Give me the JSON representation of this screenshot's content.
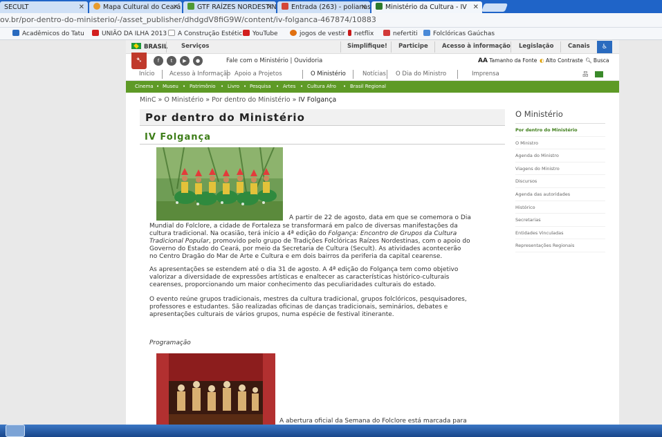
{
  "tabs": [
    {
      "label": "SECULT",
      "color": "#7aa4d8"
    },
    {
      "label": "Mapa Cultural do Ceará",
      "color": "#e89b2c"
    },
    {
      "label": "GTF RAÍZES NORDESTIN",
      "color": "#4f9a35"
    },
    {
      "label": "Entrada (263) - polianas",
      "color": "#d44638"
    },
    {
      "label": "Ministério da Cultura - IV",
      "color": "#2d7a2d"
    }
  ],
  "url": "ov.br/por-dentro-do-ministerio/-/asset_publisher/dhdgdV8fiG9W/content/iv-folganca-467874/10883",
  "bookmarks": [
    {
      "label": "Acadêmicos do Tatu",
      "color": "#2a6bbf"
    },
    {
      "label": "UNIÃO DA ILHA 2013",
      "color": "#d21f1f"
    },
    {
      "label": "A Construção Estética",
      "color": "#bbb"
    },
    {
      "label": "YouTube",
      "color": "#d21f1f"
    },
    {
      "label": "jogos de vestir",
      "color": "#e07010"
    },
    {
      "label": "netflix",
      "color": "#c81a1a"
    },
    {
      "label": "nefertiti",
      "color": "#d23a3a"
    },
    {
      "label": "Folclóricas Gaúchas",
      "color": "#4a8ad8"
    }
  ],
  "gov": {
    "brasil": "BRASIL",
    "links": [
      "Serviços",
      "Simplifique!",
      "Participe",
      "Acesso à informação",
      "Legislação",
      "Canais"
    ]
  },
  "header": {
    "fale": "Fale com o Ministério | Ouvidoria",
    "tamanho": "Tamanho da Fonte",
    "alto": "Alto Contraste",
    "busca": "Busca"
  },
  "mainmenu": [
    "Início",
    "Acesso à Informação",
    "Apoio a Projetos",
    "O Ministério",
    "Notícias",
    "O Dia do Ministro",
    "Imprensa"
  ],
  "greenmenu": [
    "Cinema",
    "Museu",
    "Patrimônio",
    "Livro",
    "Pesquisa",
    "Artes",
    "Cultura Afro",
    "Brasil Regional"
  ],
  "breadcrumb": {
    "path": "MinC » O Ministério » Por dentro do Ministério » ",
    "current": "IV Folgança"
  },
  "page_title": "Por dentro do Ministério",
  "article_title": "IV Folgança",
  "p1_first": "A partir de 22 de agosto, data em que se comemora o Dia",
  "p1_lines": [
    "Mundial do Folclore, a cidade de Fortaleza se transformará em palco de diversas manifestações da",
    "cultura tradicional. Na ocasião, terá início a 4ª edição do ",
    "Tradicional Popular",
    ", promovido pelo grupo de Tradições Folclóricas Raízes Nordestinas, com o apoio do",
    "Governo do Estado do Ceará, por meio da Secretaria de Cultura (Secult). As atividades acontecerão",
    "no Centro Dragão do Mar de Arte e Cultura e em dois bairros da periferia da capital cearense."
  ],
  "p1_italic": "Folgança: Encontro de Grupos da Cultura",
  "p2": [
    "As apresentações se estendem até o dia 31 de agosto. A 4ª edição do Folgança tem como objetivo",
    "valorizar a diversidade de expressões artísticas e enaltecer as características histórico-culturais",
    "cearenses, proporcionando um maior conhecimento das peculiaridades culturais do estado."
  ],
  "p3": [
    "O evento reúne grupos tradicionais, mestres da cultura tradicional, grupos folclóricos, pesquisadores,",
    "professores e estudantes. São realizadas oficinas de danças tradicionais, seminários, debates e",
    "apresentações culturais de vários grupos, numa espécie de festival itinerante."
  ],
  "programacao": "Programação",
  "p5": "A abertura oficial da Semana do Folclore está marcada para",
  "sidebar": {
    "title": "O Ministério",
    "items": [
      "Por dentro do Ministério",
      "O Ministro",
      "Agenda do Ministro",
      "Viagens do Ministro",
      "Discursos",
      "Agenda das autoridades",
      "Histórico",
      "Secretarias",
      "Entidades Vinculadas",
      "Representações Regionais"
    ]
  }
}
